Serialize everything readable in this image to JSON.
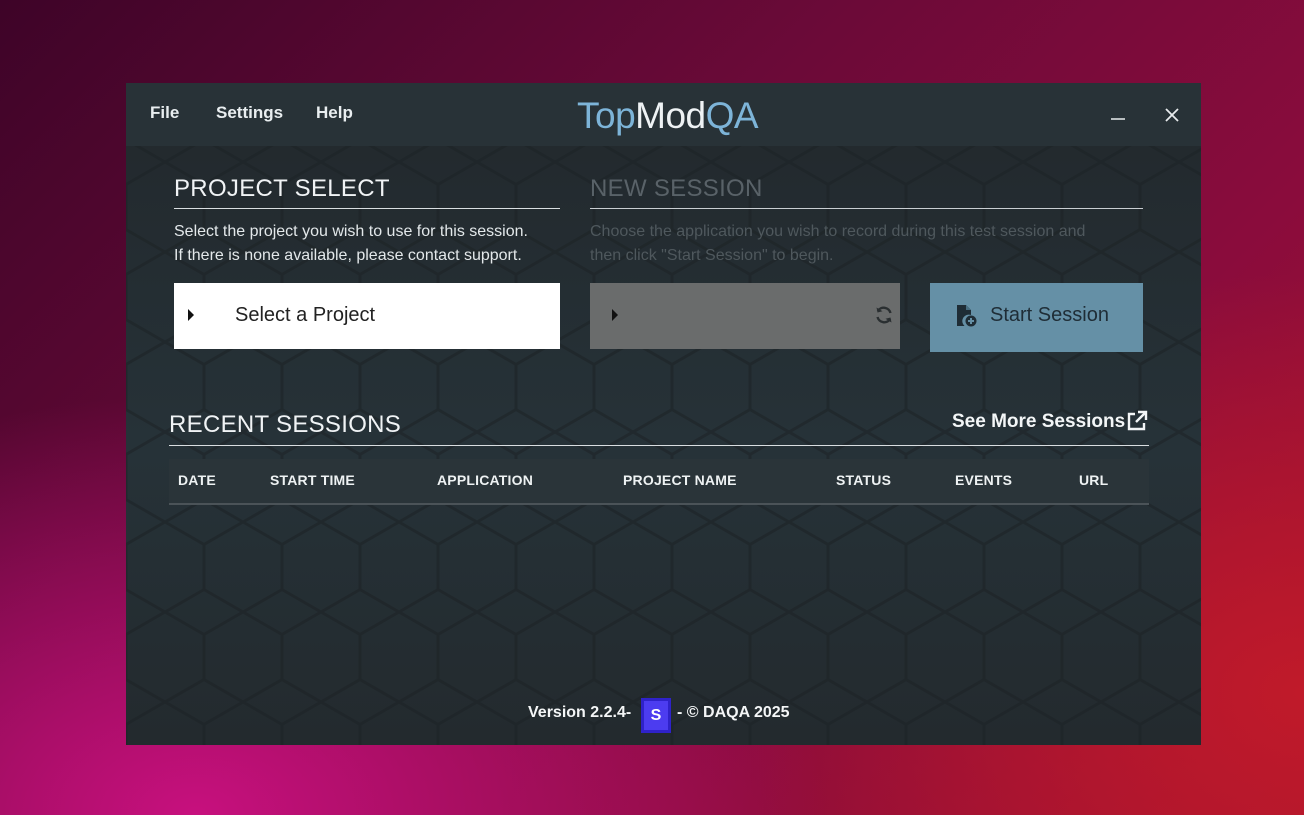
{
  "menu": {
    "file": "File",
    "settings": "Settings",
    "help": "Help"
  },
  "logo": {
    "part1": "Top",
    "part2": "Mod",
    "part3": "QA"
  },
  "window_controls": {
    "minimize_icon": "minimize-icon",
    "close_icon": "close-icon"
  },
  "project_select": {
    "title": "PROJECT SELECT",
    "description_line1": "Select the project you wish to use for this session.",
    "description_line2": "If there is none available, please contact support.",
    "dropdown_label": "Select a Project"
  },
  "new_session": {
    "title": "NEW SESSION",
    "description_line1": "Choose the application you wish to record during this test session and",
    "description_line2": "then click \"Start Session\" to begin.",
    "dropdown_label": "",
    "start_button": "Start Session"
  },
  "recent_sessions": {
    "title": "RECENT SESSIONS",
    "see_more": "See More Sessions",
    "columns": [
      "DATE",
      "START TIME",
      "APPLICATION",
      "PROJECT NAME",
      "STATUS",
      "EVENTS",
      "URL"
    ],
    "rows": []
  },
  "footer": {
    "version_text": "Version 2.2.4-",
    "badge": "S",
    "copyright": "- © DAQA 2025"
  },
  "colors": {
    "accent": "#7db4d8",
    "start_button": "#6590a6",
    "badge": "#4c3cf0",
    "window_bg": "#263238"
  }
}
